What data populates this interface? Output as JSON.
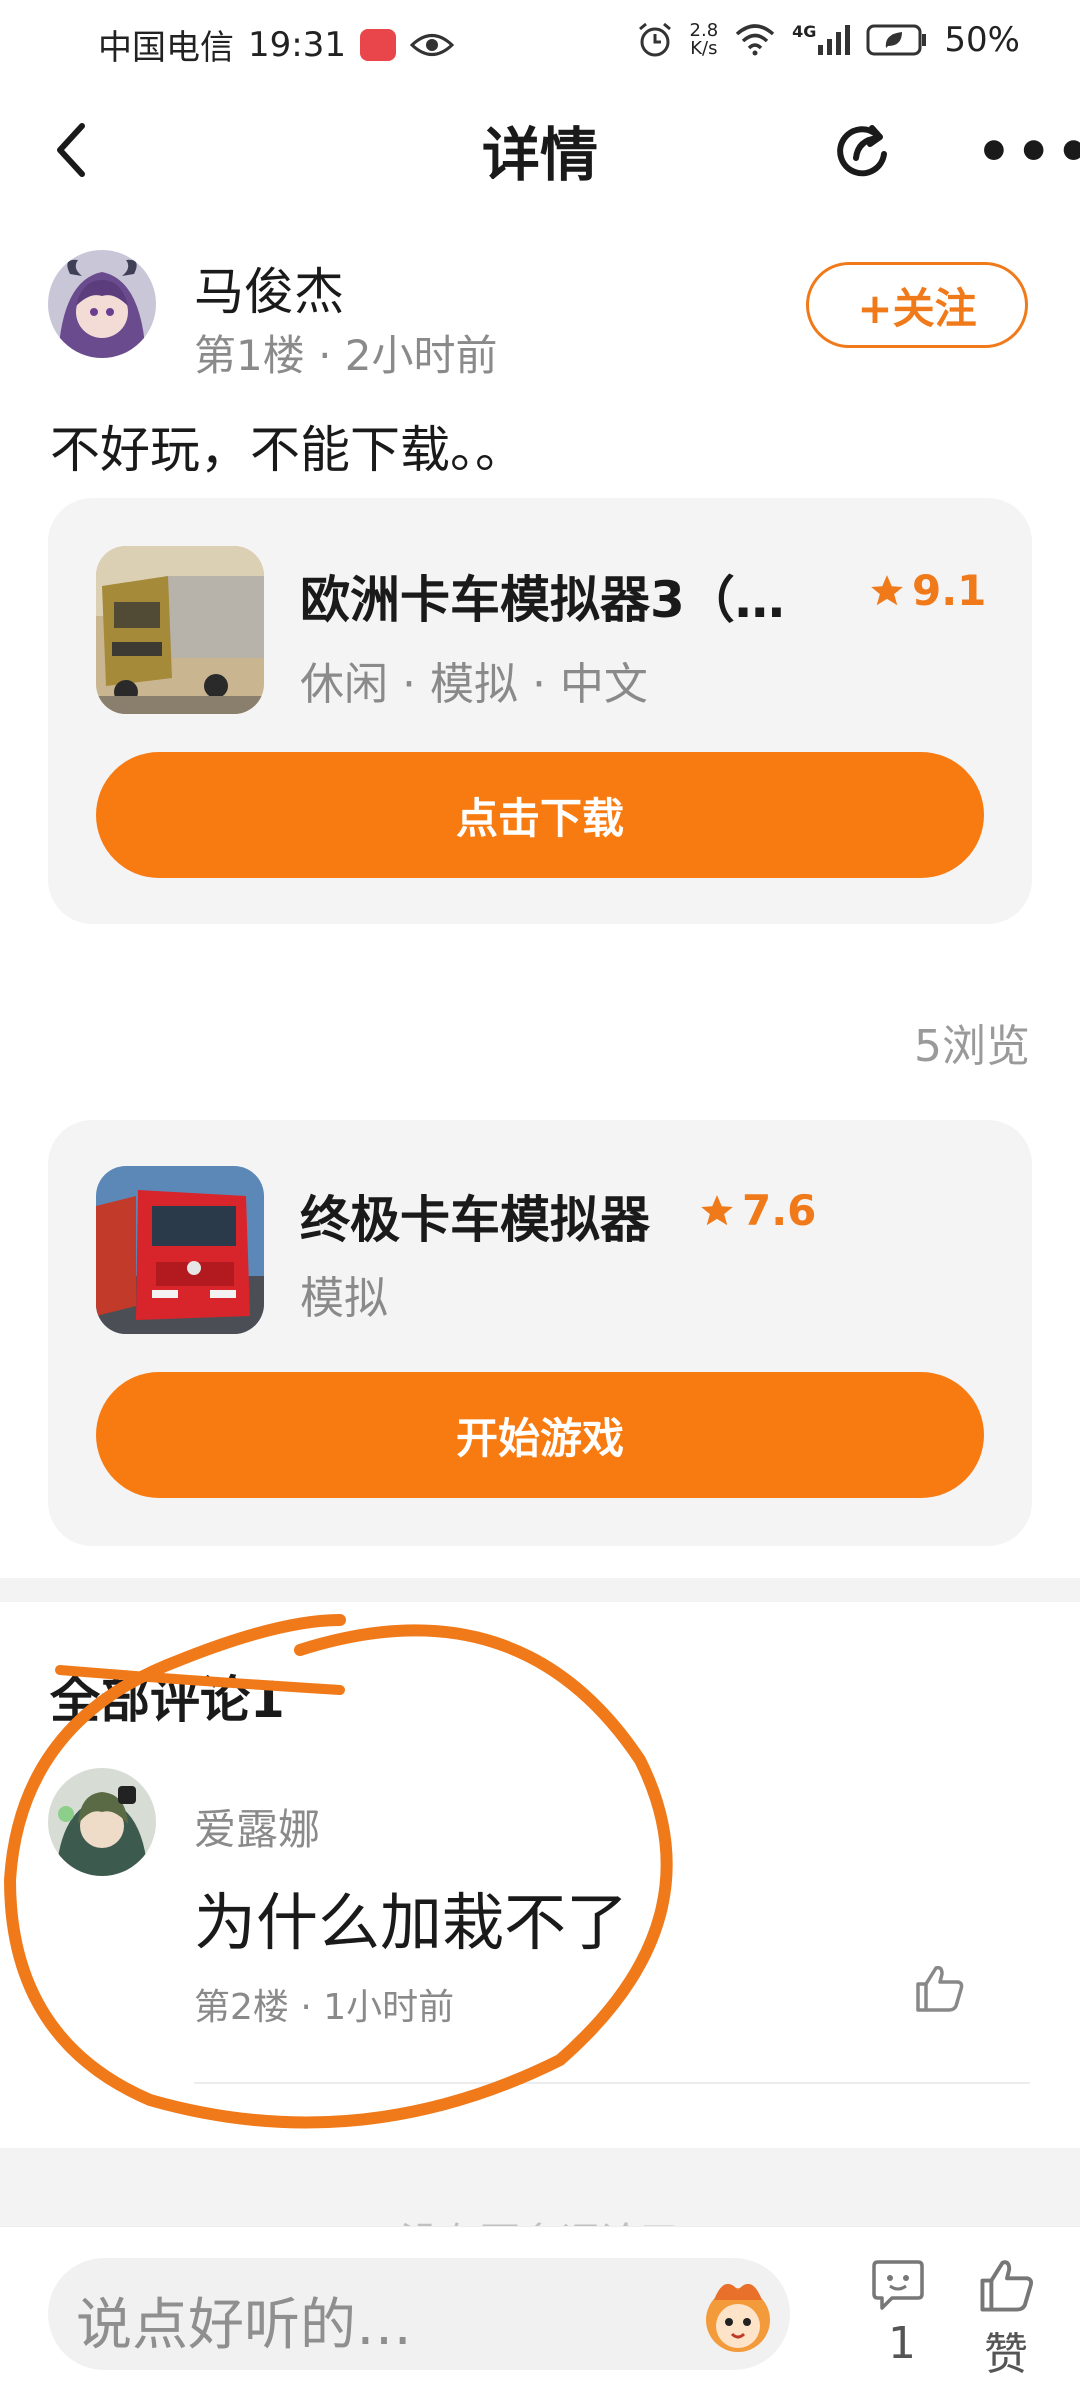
{
  "status_bar": {
    "carrier": "中国电信",
    "time": "19:31",
    "net_speed_value": "2.8",
    "net_speed_unit": "K/s",
    "network_type": "4G",
    "battery": "50%"
  },
  "header": {
    "title": "详情"
  },
  "post": {
    "author": "马俊杰",
    "meta": "第1楼 · 2小时前",
    "follow_label": "+关注",
    "text": "不好玩，不能下载。。",
    "views": "5浏览"
  },
  "games": [
    {
      "title": "欧洲卡车模拟器3（…",
      "rating": "9.1",
      "tags": "休闲 · 模拟 · 中文",
      "cta": "点击下载"
    },
    {
      "title": "终极卡车模拟器",
      "rating": "7.6",
      "tags": "模拟",
      "cta": "开始游戏"
    }
  ],
  "comments": {
    "header": "全部评论1",
    "items": [
      {
        "author": "爱露娜",
        "text": "为什么加栽不了",
        "meta": "第2楼 · 1小时前"
      }
    ],
    "no_more": "没有更多评论了"
  },
  "bottom_bar": {
    "input_placeholder": "说点好听的…",
    "comment_count": "1",
    "like_label": "赞"
  },
  "colors": {
    "accent": "#f87b12",
    "annotation": "#f07a1a"
  }
}
